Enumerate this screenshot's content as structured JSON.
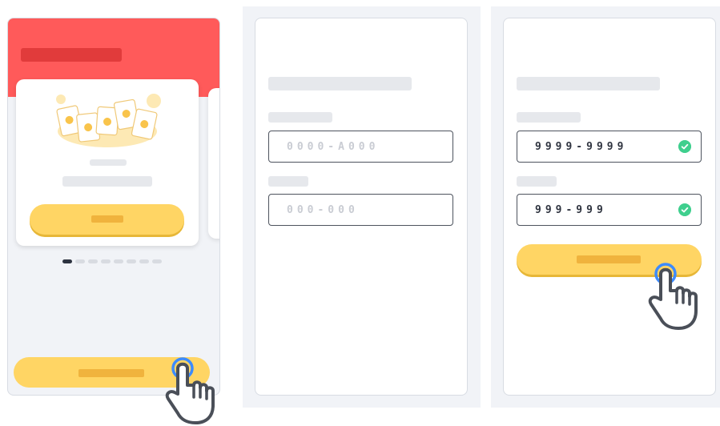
{
  "panel2": {
    "customer_field": {
      "placeholder": "0000-A000"
    },
    "sample_field": {
      "placeholder": "000-000"
    }
  },
  "panel3": {
    "customer_field": {
      "value": "9999-9999"
    },
    "sample_field": {
      "value": "999-999"
    }
  },
  "carousel": {
    "page_count": 8,
    "active_index": 0
  },
  "colors": {
    "header_red": "#ff5a5a",
    "button_yellow": "#ffd564",
    "check_green": "#3fcf8e",
    "tap_blue": "#3d8bfd"
  },
  "icons": [
    "pointer-hand-icon",
    "tap-ring-icon",
    "check-circle-icon",
    "emoji-cards-illustration"
  ]
}
